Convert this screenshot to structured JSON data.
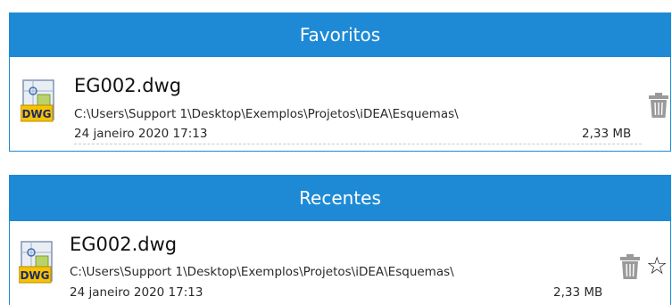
{
  "favorites": {
    "header": "Favoritos",
    "item": {
      "name": "EG002.dwg",
      "path": "C:\\Users\\Support 1\\Desktop\\Exemplos\\Projetos\\iDEA\\Esquemas\\",
      "date": "24 janeiro 2020 17:13",
      "size": "2,33 MB",
      "icon": "dwg-file-icon",
      "icon_label": "DWG"
    }
  },
  "recents": {
    "header": "Recentes",
    "item": {
      "name": "EG002.dwg",
      "path": "C:\\Users\\Support 1\\Desktop\\Exemplos\\Projetos\\iDEA\\Esquemas\\",
      "date": "24 janeiro 2020 17:13",
      "size": "2,33 MB",
      "icon": "dwg-file-icon",
      "icon_label": "DWG"
    }
  },
  "colors": {
    "header_bg": "#1e8ad6",
    "header_text": "#ffffff",
    "trash_icon": "#9a9a9a"
  }
}
